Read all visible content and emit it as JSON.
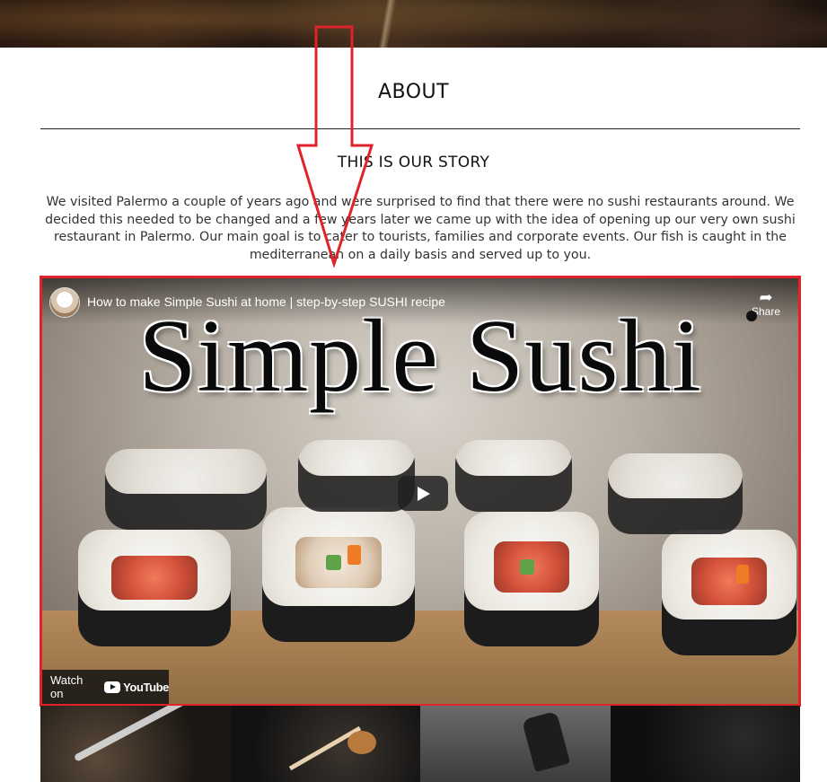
{
  "about": {
    "title": "ABOUT",
    "story_title": "THIS IS OUR STORY",
    "story_text": "We visited Palermo a couple of years ago and were surprised to find that there were no sushi restaurants around. We decided this needed to be changed and a few years later we came up with the idea of opening up our very own sushi restaurant in Palermo. Our main goal is to cater to tourists, families and corporate events. Our fish is caught in the mediterranean on a daily basis and served up to you."
  },
  "video": {
    "title": "How to make Simple Sushi at home | step-by-step SUSHI recipe",
    "thumbnail_text": "Simple Sushi",
    "share_label": "Share",
    "watch_on_label": "Watch on",
    "youtube_label": "YouTube",
    "highlight_color": "#e0222a"
  },
  "annotation": {
    "arrow_color": "#e0222a"
  },
  "icons": {
    "share": "share-arrow-icon",
    "play": "play-icon",
    "youtube": "youtube-logo-icon"
  }
}
